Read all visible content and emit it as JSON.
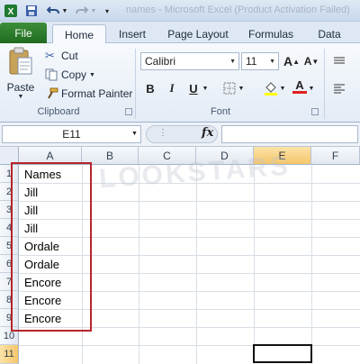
{
  "title_bar": {
    "text": "names - Microsoft Excel (Product Activation Failed)"
  },
  "tabs": [
    {
      "label": "File"
    },
    {
      "label": "Home"
    },
    {
      "label": "Insert"
    },
    {
      "label": "Page Layout"
    },
    {
      "label": "Formulas"
    },
    {
      "label": "Data"
    }
  ],
  "clipboard": {
    "paste": "Paste",
    "cut": "Cut",
    "copy": "Copy",
    "format_painter": "Format Painter",
    "group_label": "Clipboard"
  },
  "font": {
    "name": "Calibri",
    "size": "11",
    "bold": "B",
    "italic": "I",
    "underline": "U",
    "grow": "A",
    "shrink": "A",
    "font_color": "A",
    "group_label": "Font"
  },
  "formula_bar": {
    "name_box": "E11",
    "fx": "fx",
    "formula": ""
  },
  "columns": [
    "A",
    "B",
    "C",
    "D",
    "E",
    "F"
  ],
  "rows": [
    "1",
    "2",
    "3",
    "4",
    "5",
    "6",
    "7",
    "8",
    "9",
    "10",
    "11"
  ],
  "cells_a": [
    "Names",
    "Jill",
    "Jill",
    "Jill",
    "Ordale",
    "Ordale",
    "Encore",
    "Encore",
    "Encore"
  ],
  "watermark": "LOOKSTARS",
  "colors": {
    "file_tab": "#2a7a2a",
    "highlight_border": "#b7242b",
    "selected_header": "#f5c66a"
  }
}
